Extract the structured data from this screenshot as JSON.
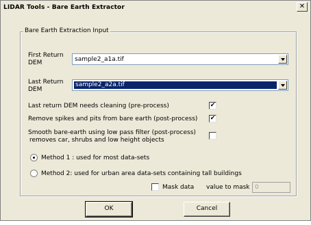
{
  "window": {
    "title": "LIDAR Tools - Bare Earth Extractor",
    "close_glyph": "✕"
  },
  "group": {
    "legend": "Bare Earth Extraction Input"
  },
  "first_return": {
    "label_line1": "First Return",
    "label_line2": "DEM",
    "value": "sample2_a1a.tif"
  },
  "last_return": {
    "label_line1": "Last Return",
    "label_line2": "DEM",
    "value": "sample2_a2a.tif"
  },
  "options": {
    "clean_label": "Last return DEM needs cleaning (pre-process)",
    "clean_checked": true,
    "spikes_label": "Remove spikes and pits from bare earth (post-process)",
    "spikes_checked": true,
    "smooth_label_line1": "Smooth bare-earth using low pass filter (post-process)",
    "smooth_label_line2": "removes car, shrubs and low height objects",
    "smooth_checked": false
  },
  "methods": {
    "method1_label": "Method 1 : used for most data-sets",
    "method1_selected": true,
    "method2_label": "Method 2: used for urban area data-sets containing tall buildings",
    "method2_selected": false
  },
  "mask": {
    "checkbox_label": "Mask data",
    "checked": false,
    "value_label": "value to mask",
    "value": "0"
  },
  "buttons": {
    "ok": "OK",
    "cancel": "Cancel"
  },
  "check_glyph": "✔",
  "colors": {
    "face": "#ece9d8",
    "selection": "#0a246a"
  }
}
